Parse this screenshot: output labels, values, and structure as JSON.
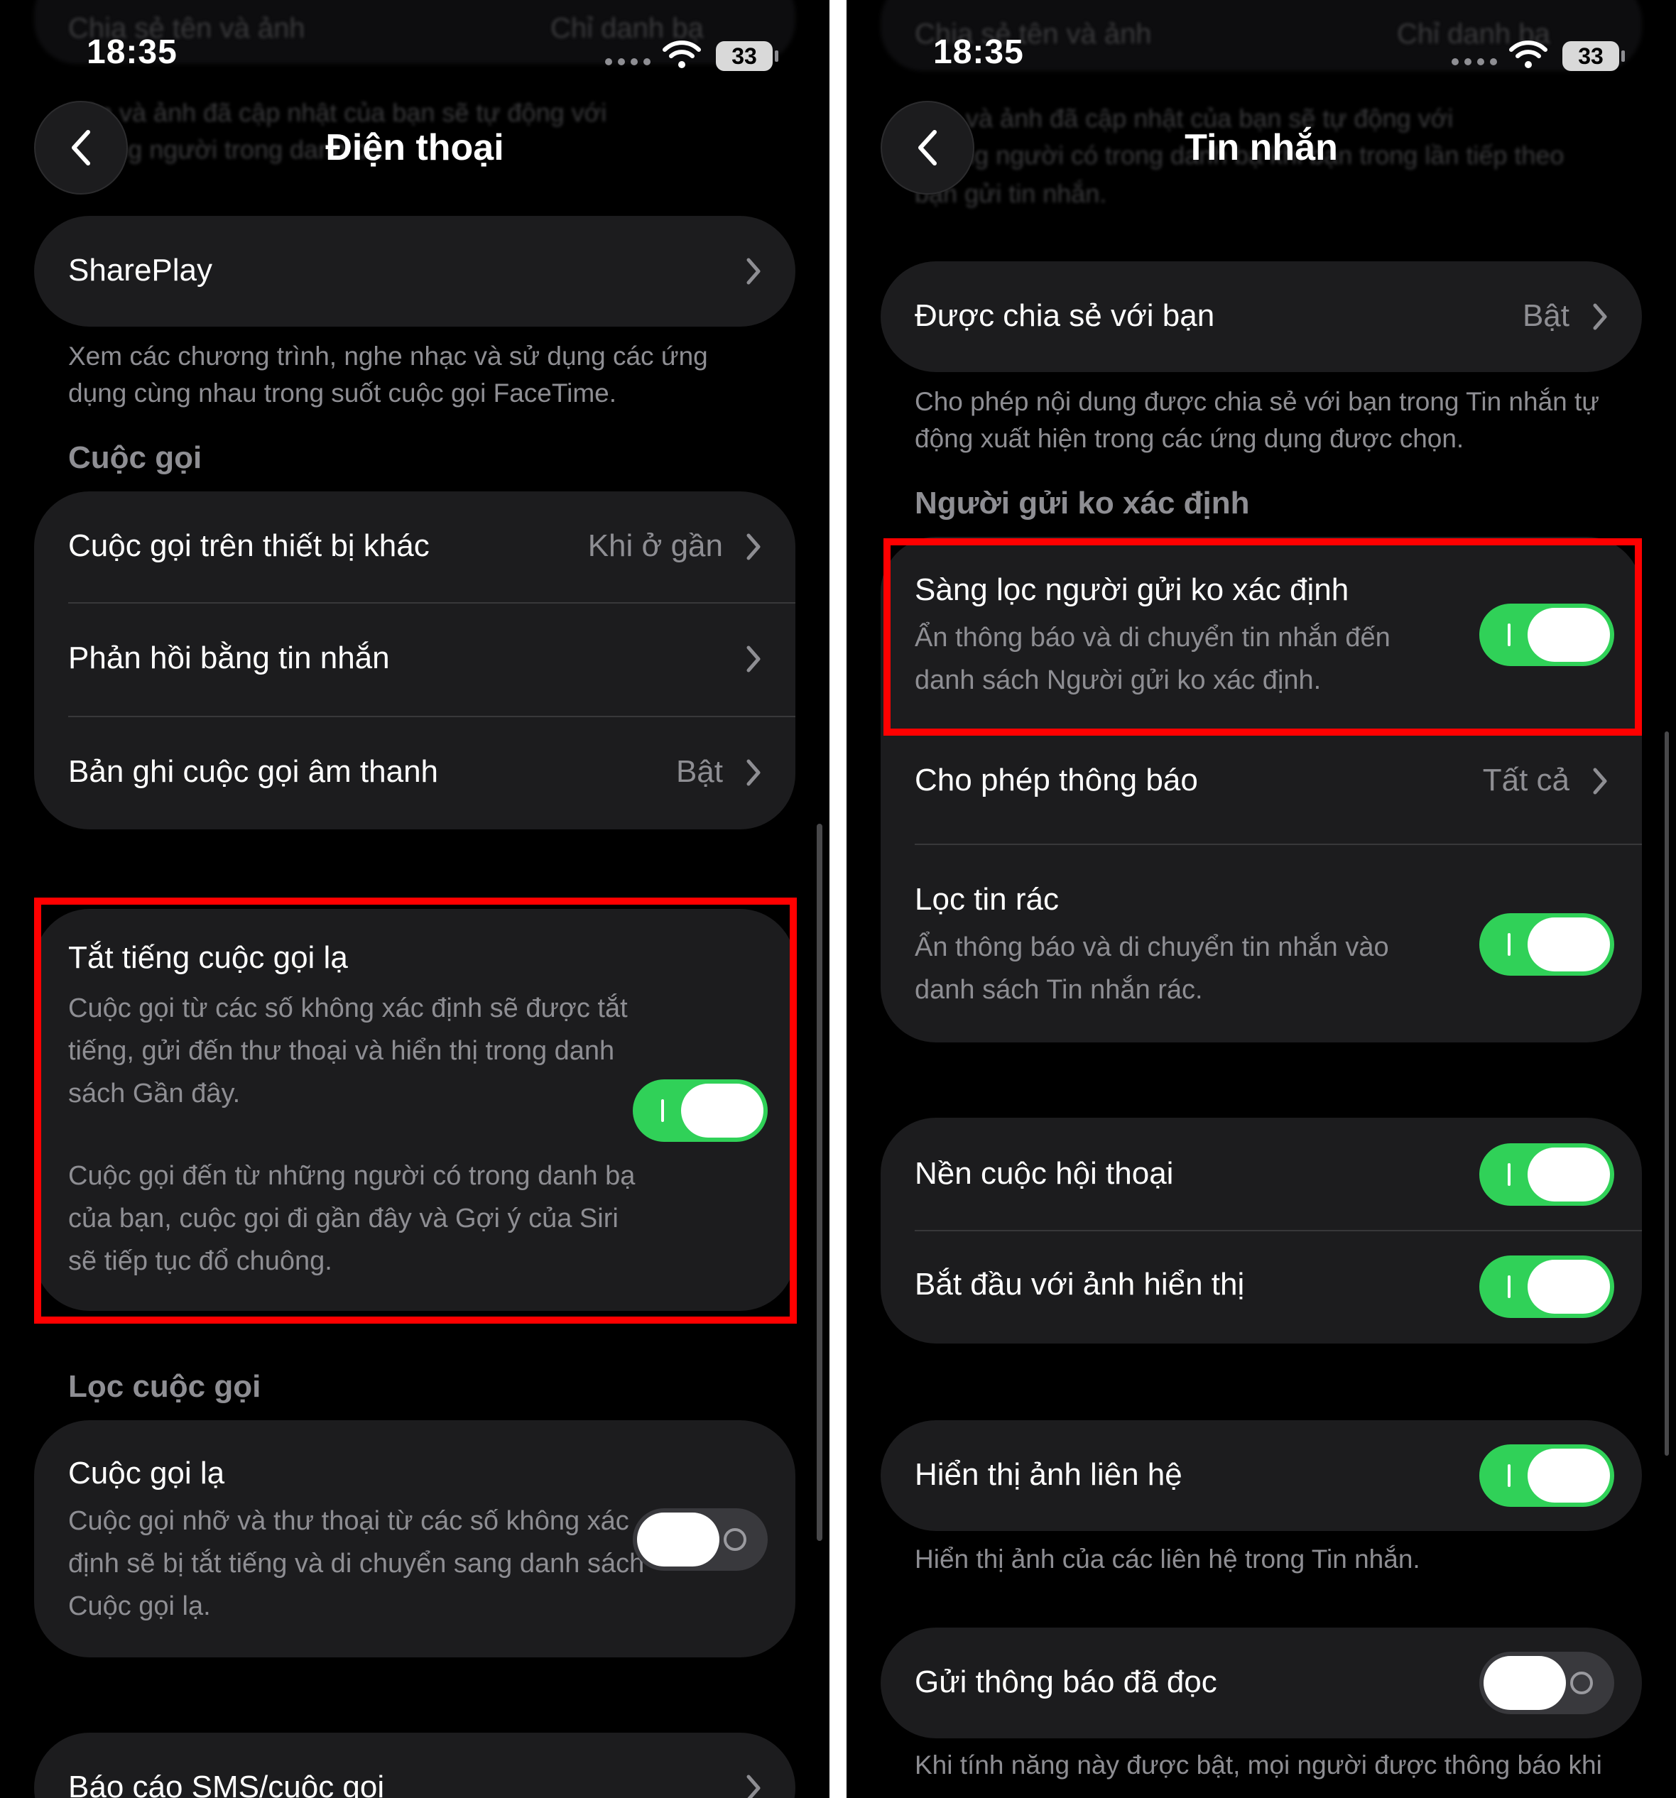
{
  "colors": {
    "accent_toggle_on": "#30d158",
    "highlight": "#ff0000",
    "background": "#000000",
    "card": "#1c1c1e",
    "secondary_text": "#8e8e93"
  },
  "status_bar": {
    "time": "18:35",
    "battery": "33"
  },
  "left": {
    "title": "Điện thoại",
    "shareplay": {
      "label": "SharePlay"
    },
    "shareplay_footer": "Xem các chương trình, nghe nhạc và sử dụng các ứng dụng cùng nhau trong suốt cuộc gọi FaceTime.",
    "calls_header": "Cuộc gọi",
    "calls": [
      {
        "label": "Cuộc gọi trên thiết bị khác",
        "value": "Khi ở gần"
      },
      {
        "label": "Phản hồi bằng tin nhắn",
        "value": ""
      },
      {
        "label": "Bản ghi cuộc gọi âm thanh",
        "value": "Bật"
      }
    ],
    "silence": {
      "label": "Tắt tiếng cuộc gọi lạ",
      "desc1": "Cuộc gọi từ các số không xác định sẽ được tắt tiếng, gửi đến thư thoại và hiển thị trong danh sách Gần đây.",
      "desc2": "Cuộc gọi đến từ những người có trong danh bạ của bạn, cuộc gọi đi gần đây và Gợi ý của Siri sẽ tiếp tục đổ chuông.",
      "enabled": true
    },
    "filter_header": "Lọc cuộc gọi",
    "unknown": {
      "label": "Cuộc gọi lạ",
      "desc": "Cuộc gọi nhỡ và thư thoại từ các số không xác định sẽ bị tắt tiếng và di chuyển sang danh sách Cuộc gọi lạ.",
      "enabled": false
    },
    "report": {
      "label": "Báo cáo SMS/cuộc gọi"
    },
    "ghost": {
      "line1": "Chia sẻ tên và ảnh",
      "line1_value": "Chỉ danh bạ",
      "line2": "Tên và ảnh đã cập nhật của bạn sẽ tự động với",
      "line3": "những người trong danh bạ"
    }
  },
  "right": {
    "title": "Tin nhắn",
    "ghost": {
      "line1": "Chia sẻ tên và ảnh",
      "line1_value": "Chỉ danh bạ",
      "line2": "Tên và ảnh đã cập nhật của bạn sẽ tự động với",
      "line3": "những người có trong danh bạ khi bạn trong lần tiếp theo",
      "line4": "bạn gửi tin nhắn."
    },
    "shared": {
      "label": "Được chia sẻ với bạn",
      "value": "Bật"
    },
    "shared_footer": "Cho phép nội dung được chia sẻ với bạn trong Tin nhắn tự động xuất hiện trong các ứng dụng được chọn.",
    "unknown_header": "Người gửi ko xác định",
    "filter_unknown": {
      "label": "Sàng lọc người gửi ko xác định",
      "desc": "Ẩn thông báo và di chuyển tin nhắn đến danh sách Người gửi ko xác định.",
      "enabled": true
    },
    "allow_notif": {
      "label": "Cho phép thông báo",
      "value": "Tất cả"
    },
    "junk": {
      "label": "Lọc tin rác",
      "desc": "Ẩn thông báo và di chuyển tin nhắn vào danh sách Tin nhắn rác.",
      "enabled": true
    },
    "conv_bg": {
      "label": "Nền cuộc hội thoại",
      "enabled": true
    },
    "start_photo": {
      "label": "Bắt đầu với ảnh hiển thị",
      "enabled": true
    },
    "contact_photos": {
      "label": "Hiển thị ảnh liên hệ",
      "enabled": true
    },
    "contact_photos_footer": "Hiển thị ảnh của các liên hệ trong Tin nhắn.",
    "read_receipts": {
      "label": "Gửi thông báo đã đọc",
      "enabled": false
    },
    "read_receipts_footer": "Khi tính năng này được bật, mọi người được thông báo khi"
  }
}
